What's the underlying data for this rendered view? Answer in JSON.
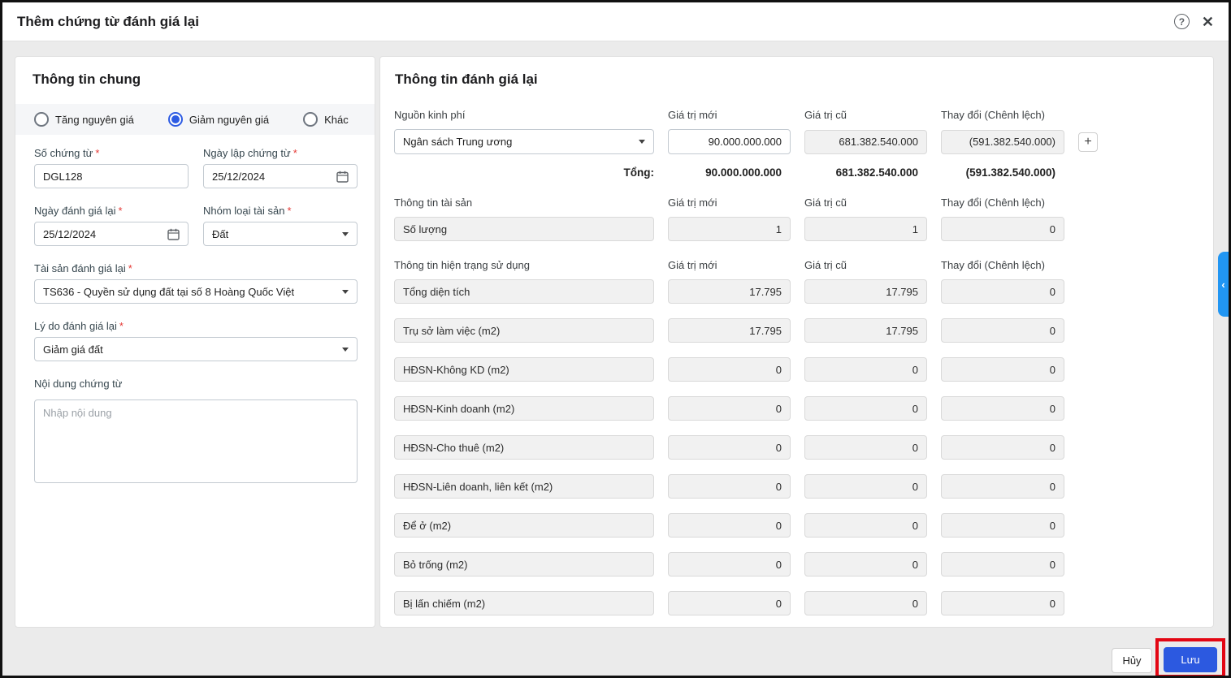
{
  "colors": {
    "accent": "#2d5be3",
    "save_button": "#2c59e0",
    "side_tab": "#2196f3",
    "annotation": "#e30613",
    "required": "#e53935"
  },
  "required_mark": "*",
  "dialog": {
    "title": "Thêm chứng từ đánh giá lại",
    "help_icon": "?",
    "close_icon": "✕"
  },
  "general": {
    "title": "Thông tin chung",
    "radios": [
      {
        "label": "Tăng nguyên giá",
        "checked": false
      },
      {
        "label": "Giảm nguyên giá",
        "checked": true
      },
      {
        "label": "Khác",
        "checked": false
      }
    ],
    "fields": {
      "so_chung_tu": {
        "label": "Số chứng từ",
        "value": "DGL128",
        "required": true
      },
      "ngay_lap": {
        "label": "Ngày lập chứng từ",
        "value": "25/12/2024",
        "required": true
      },
      "ngay_danh_gia": {
        "label": "Ngày đánh giá lại",
        "value": "25/12/2024",
        "required": true
      },
      "nhom_loai": {
        "label": "Nhóm loại tài sản",
        "value": "Đất",
        "required": true
      },
      "tai_san": {
        "label": "Tài sản đánh giá lại",
        "value": "TS636 - Quyền sử dụng đất tại số 8 Hoàng Quốc Việt",
        "required": true
      },
      "ly_do": {
        "label": "Lý do đánh giá lại",
        "value": "Giảm giá đất",
        "required": true
      },
      "noi_dung": {
        "label": "Nội dung chứng từ",
        "placeholder": "Nhập nội dung",
        "value": ""
      }
    }
  },
  "revaluation": {
    "title": "Thông tin đánh giá lại",
    "columns": {
      "source": "Nguồn kinh phí",
      "new": "Giá trị mới",
      "old": "Giá trị cũ",
      "change": "Thay đổi (Chênh lệch)"
    },
    "funding_row": {
      "source": "Ngân sách Trung ương",
      "new_value": "90.000.000.000",
      "old_value": "681.382.540.000",
      "change_value": "(591.382.540.000)",
      "add_label": "+"
    },
    "total": {
      "label": "Tổng:",
      "new_value": "90.000.000.000",
      "old_value": "681.382.540.000",
      "change_value": "(591.382.540.000)"
    },
    "asset_section": {
      "title": "Thông tin tài sản",
      "rows": [
        {
          "label": "Số lượng",
          "new": "1",
          "old": "1",
          "change": "0"
        }
      ]
    },
    "usage_section": {
      "title": "Thông tin hiện trạng sử dụng",
      "rows": [
        {
          "label": "Tổng diện tích",
          "new": "17.795",
          "old": "17.795",
          "change": "0"
        },
        {
          "label": "Trụ sở làm việc (m2)",
          "new": "17.795",
          "old": "17.795",
          "change": "0"
        },
        {
          "label": "HĐSN-Không KD (m2)",
          "new": "0",
          "old": "0",
          "change": "0"
        },
        {
          "label": "HĐSN-Kinh doanh (m2)",
          "new": "0",
          "old": "0",
          "change": "0"
        },
        {
          "label": "HĐSN-Cho thuê (m2)",
          "new": "0",
          "old": "0",
          "change": "0"
        },
        {
          "label": "HĐSN-Liên doanh, liên kết (m2)",
          "new": "0",
          "old": "0",
          "change": "0"
        },
        {
          "label": "Để ở (m2)",
          "new": "0",
          "old": "0",
          "change": "0"
        },
        {
          "label": "Bỏ trống (m2)",
          "new": "0",
          "old": "0",
          "change": "0"
        },
        {
          "label": "Bị lấn chiếm (m2)",
          "new": "0",
          "old": "0",
          "change": "0"
        }
      ]
    }
  },
  "side_tab": {
    "chevron": "‹"
  },
  "footer": {
    "cancel_label": "Hủy",
    "save_label": "Lưu"
  }
}
